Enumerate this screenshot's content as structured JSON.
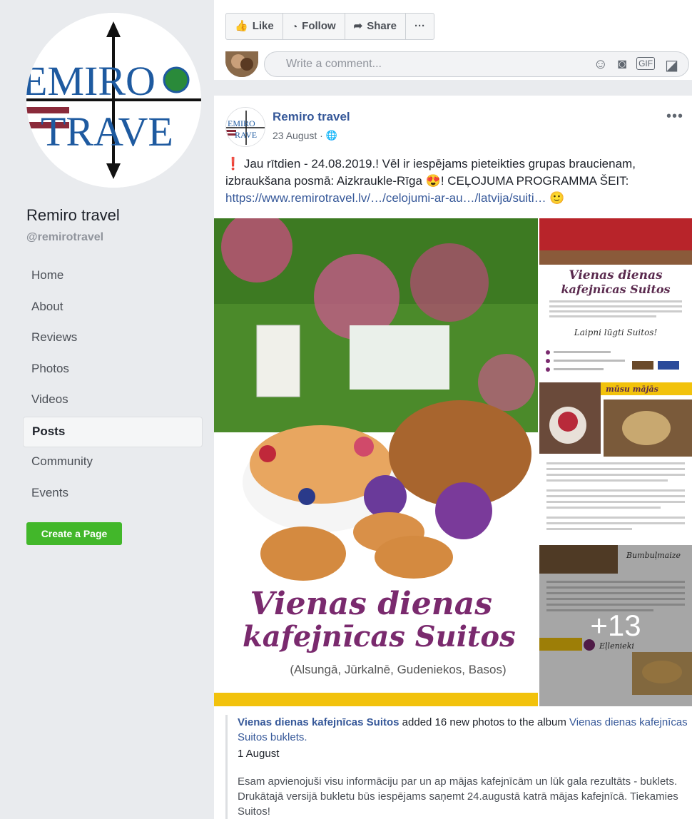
{
  "page": {
    "name": "Remiro travel",
    "handle": "@remirotravel",
    "logo_text_top": "EMIRO",
    "logo_text_bottom": "TRAVE"
  },
  "nav": {
    "items": [
      "Home",
      "About",
      "Reviews",
      "Photos",
      "Videos",
      "Posts",
      "Community",
      "Events"
    ],
    "active": "Posts",
    "create_label": "Create a Page"
  },
  "actions": {
    "like": "Like",
    "follow": "Follow",
    "share": "Share",
    "more": "···"
  },
  "comment": {
    "placeholder": "Write a comment..."
  },
  "post": {
    "author": "Remiro travel",
    "date": "23 August · ",
    "text_lead": "Jau rītdien - 24.08.2019.! Vēl ir iespējams pieteikties grupas braucienam, izbraukšana posmā: Aizkraukle-Rīga ",
    "text_mid": "! CEĻOJUMA PROGRAMMA ŠEIT: ",
    "link": "https://www.remirotravel.lv/…/celojumi-ar-au…/latvija/suiti…",
    "main_photo_title1": "Vienas dienas",
    "main_photo_title2": "kafejnīcas Suitos",
    "main_photo_caption": "(Alsungā, Jūrkalnē, Gudeniekos, Basos)",
    "thumb1_title1": "Vienas dienas",
    "thumb1_title2": "kafejnīcas Suitos",
    "thumb1_greeting": "Laipni lūgti Suitos!",
    "thumb2_heading": "mūsu mājās",
    "thumb3_heading": "Bumbuļmaize",
    "thumb3_sub": "Eļlenieki",
    "more_photos": "+13"
  },
  "shared": {
    "actor": "Vienas dienas kafejnīcas Suitos",
    "verb": " added 16 new photos to the album ",
    "album": "Vienas dienas kafejnīcas Suitos buklets.",
    "date": "1 August",
    "body": "Esam apvienojuši visu informāciju par un ap mājas kafejnīcām un lūk gala rezultāts - buklets. Drukātajā versijā bukletu būs iespējams saņemt 24.augustā katrā mājas kafejnīcā. Tiekamies Suitos!"
  },
  "colors": {
    "link": "#365899",
    "green": "#42b72a",
    "title_purple": "#7a2a6e"
  }
}
